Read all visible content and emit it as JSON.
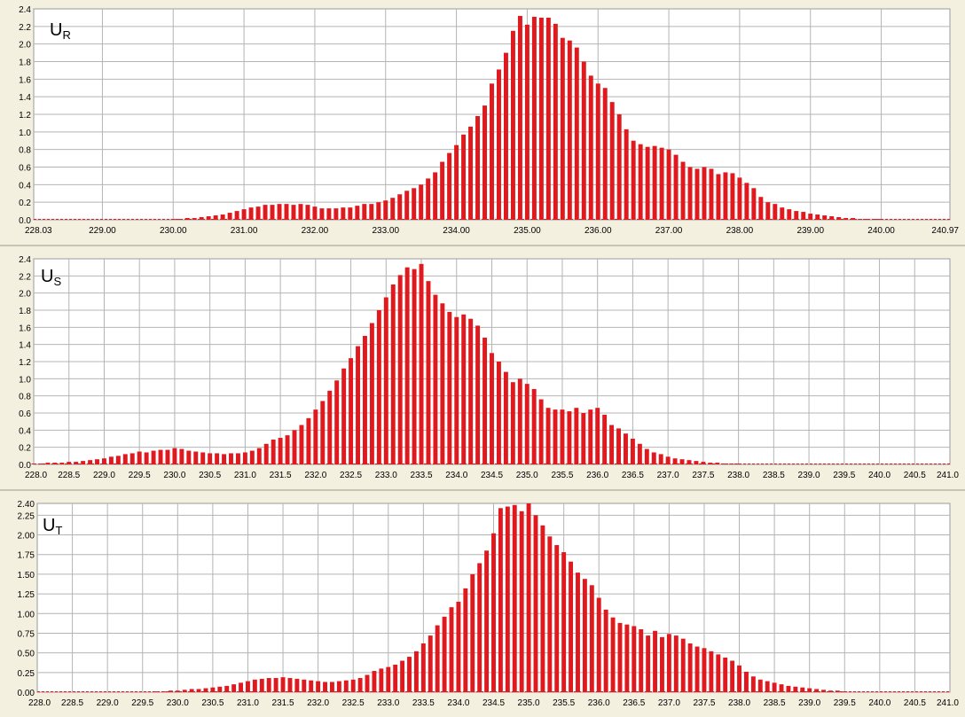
{
  "colors": {
    "bar": "#e0191e",
    "grid": "#b4b4b4",
    "baseline": "#e0191e",
    "panel_bg": "#f4f0e0",
    "plot_bg": "#ffffff"
  },
  "chart_data": [
    {
      "type": "bar",
      "label_main": "U",
      "label_sub": "R",
      "xlim": [
        228.03,
        240.97
      ],
      "ylim": [
        0,
        2.4
      ],
      "x_ticks": [
        "228.03",
        "229.00",
        "230.00",
        "231.00",
        "232.00",
        "233.00",
        "234.00",
        "235.00",
        "236.00",
        "237.00",
        "238.00",
        "239.00",
        "240.00",
        "240.97"
      ],
      "y_ticks": [
        "0.0",
        "0.2",
        "0.4",
        "0.6",
        "0.8",
        "1.0",
        "1.2",
        "1.4",
        "1.6",
        "1.8",
        "2.0",
        "2.2",
        "2.4"
      ],
      "grid": true,
      "x": [
        230.0,
        230.1,
        230.2,
        230.3,
        230.4,
        230.5,
        230.6,
        230.7,
        230.8,
        230.9,
        231.0,
        231.1,
        231.2,
        231.3,
        231.4,
        231.5,
        231.6,
        231.7,
        231.8,
        231.9,
        232.0,
        232.1,
        232.2,
        232.3,
        232.4,
        232.5,
        232.6,
        232.7,
        232.8,
        232.9,
        233.0,
        233.1,
        233.2,
        233.3,
        233.4,
        233.5,
        233.6,
        233.7,
        233.8,
        233.9,
        234.0,
        234.1,
        234.2,
        234.3,
        234.4,
        234.5,
        234.6,
        234.7,
        234.8,
        234.9,
        235.0,
        235.1,
        235.2,
        235.3,
        235.4,
        235.5,
        235.6,
        235.7,
        235.8,
        235.9,
        236.0,
        236.1,
        236.2,
        236.3,
        236.4,
        236.5,
        236.6,
        236.7,
        236.8,
        236.9,
        237.0,
        237.1,
        237.2,
        237.3,
        237.4,
        237.5,
        237.6,
        237.7,
        237.8,
        237.9,
        238.0,
        238.1,
        238.2,
        238.3,
        238.4,
        238.5,
        238.6,
        238.7,
        238.8,
        238.9,
        239.0,
        239.1,
        239.2,
        239.3,
        239.4,
        239.5,
        239.6,
        239.7,
        239.8,
        239.9,
        240.0
      ],
      "values": [
        0.01,
        0.01,
        0.02,
        0.02,
        0.03,
        0.04,
        0.05,
        0.06,
        0.08,
        0.1,
        0.12,
        0.14,
        0.15,
        0.17,
        0.17,
        0.18,
        0.18,
        0.17,
        0.18,
        0.17,
        0.15,
        0.13,
        0.13,
        0.13,
        0.14,
        0.14,
        0.16,
        0.18,
        0.18,
        0.2,
        0.22,
        0.25,
        0.29,
        0.33,
        0.36,
        0.4,
        0.47,
        0.54,
        0.66,
        0.76,
        0.85,
        0.97,
        1.06,
        1.18,
        1.3,
        1.55,
        1.71,
        1.9,
        2.15,
        2.32,
        2.22,
        2.31,
        2.3,
        2.3,
        2.23,
        2.07,
        2.04,
        1.96,
        1.8,
        1.64,
        1.55,
        1.5,
        1.34,
        1.2,
        1.03,
        0.9,
        0.86,
        0.83,
        0.84,
        0.82,
        0.8,
        0.74,
        0.66,
        0.6,
        0.58,
        0.6,
        0.58,
        0.52,
        0.54,
        0.53,
        0.48,
        0.42,
        0.36,
        0.26,
        0.2,
        0.18,
        0.14,
        0.12,
        0.1,
        0.09,
        0.07,
        0.06,
        0.05,
        0.04,
        0.03,
        0.02,
        0.02,
        0.01,
        0.01,
        0.01,
        0.01
      ]
    },
    {
      "type": "bar",
      "label_main": "U",
      "label_sub": "S",
      "xlim": [
        228.0,
        241.0
      ],
      "ylim": [
        0,
        2.4
      ],
      "x_ticks": [
        "228.0",
        "228.5",
        "229.0",
        "229.5",
        "230.0",
        "230.5",
        "231.0",
        "231.5",
        "232.0",
        "232.5",
        "233.0",
        "233.5",
        "234.0",
        "234.5",
        "235.0",
        "235.5",
        "236.0",
        "236.5",
        "237.0",
        "237.5",
        "238.0",
        "238.5",
        "239.0",
        "239.5",
        "240.0",
        "240.5",
        "241.0"
      ],
      "y_ticks": [
        "0.0",
        "0.2",
        "0.4",
        "0.6",
        "0.8",
        "1.0",
        "1.2",
        "1.4",
        "1.6",
        "1.8",
        "2.0",
        "2.2",
        "2.4"
      ],
      "grid": true,
      "x": [
        228.0,
        228.1,
        228.2,
        228.3,
        228.4,
        228.5,
        228.6,
        228.7,
        228.8,
        228.9,
        229.0,
        229.1,
        229.2,
        229.3,
        229.4,
        229.5,
        229.6,
        229.7,
        229.8,
        229.9,
        230.0,
        230.1,
        230.2,
        230.3,
        230.4,
        230.5,
        230.6,
        230.7,
        230.8,
        230.9,
        231.0,
        231.1,
        231.2,
        231.3,
        231.4,
        231.5,
        231.6,
        231.7,
        231.8,
        231.9,
        232.0,
        232.1,
        232.2,
        232.3,
        232.4,
        232.5,
        232.6,
        232.7,
        232.8,
        232.9,
        233.0,
        233.1,
        233.2,
        233.3,
        233.4,
        233.5,
        233.6,
        233.7,
        233.8,
        233.9,
        234.0,
        234.1,
        234.2,
        234.3,
        234.4,
        234.5,
        234.6,
        234.7,
        234.8,
        234.9,
        235.0,
        235.1,
        235.2,
        235.3,
        235.4,
        235.5,
        235.6,
        235.7,
        235.8,
        235.9,
        236.0,
        236.1,
        236.2,
        236.3,
        236.4,
        236.5,
        236.6,
        236.7,
        236.8,
        236.9,
        237.0,
        237.1,
        237.2,
        237.3,
        237.4,
        237.5,
        237.6,
        237.7,
        237.8,
        237.9,
        238.0
      ],
      "values": [
        0.01,
        0.01,
        0.02,
        0.02,
        0.02,
        0.03,
        0.03,
        0.04,
        0.05,
        0.06,
        0.07,
        0.09,
        0.1,
        0.12,
        0.13,
        0.15,
        0.14,
        0.16,
        0.17,
        0.17,
        0.19,
        0.18,
        0.16,
        0.15,
        0.14,
        0.13,
        0.13,
        0.12,
        0.13,
        0.13,
        0.14,
        0.16,
        0.19,
        0.24,
        0.29,
        0.31,
        0.34,
        0.4,
        0.46,
        0.54,
        0.64,
        0.74,
        0.86,
        0.98,
        1.12,
        1.24,
        1.38,
        1.5,
        1.65,
        1.8,
        1.95,
        2.1,
        2.21,
        2.3,
        2.28,
        2.34,
        2.14,
        1.98,
        1.88,
        1.78,
        1.72,
        1.75,
        1.7,
        1.62,
        1.48,
        1.3,
        1.2,
        1.08,
        0.96,
        1.0,
        0.94,
        0.88,
        0.76,
        0.66,
        0.64,
        0.64,
        0.62,
        0.66,
        0.6,
        0.64,
        0.66,
        0.58,
        0.46,
        0.42,
        0.36,
        0.3,
        0.24,
        0.18,
        0.14,
        0.12,
        0.09,
        0.07,
        0.06,
        0.05,
        0.04,
        0.03,
        0.02,
        0.02,
        0.01,
        0.01,
        0.01
      ]
    },
    {
      "type": "bar",
      "label_main": "U",
      "label_sub": "T",
      "xlim": [
        228.0,
        241.0
      ],
      "ylim": [
        0,
        2.4
      ],
      "x_ticks": [
        "228.0",
        "228.5",
        "229.0",
        "229.5",
        "230.0",
        "230.5",
        "231.0",
        "231.5",
        "232.0",
        "232.5",
        "233.0",
        "233.5",
        "234.0",
        "234.5",
        "235.0",
        "235.5",
        "236.0",
        "236.5",
        "237.0",
        "237.5",
        "238.0",
        "238.5",
        "239.0",
        "239.5",
        "240.0",
        "240.5",
        "241.0"
      ],
      "y_ticks": [
        "0.00",
        "0.25",
        "0.50",
        "0.75",
        "1.00",
        "1.25",
        "1.50",
        "1.75",
        "2.00",
        "2.25",
        "2.40"
      ],
      "y_tick_values": [
        0,
        0.25,
        0.5,
        0.75,
        1.0,
        1.25,
        1.5,
        1.75,
        2.0,
        2.25,
        2.4
      ],
      "grid": true,
      "x": [
        229.7,
        229.8,
        229.9,
        230.0,
        230.1,
        230.2,
        230.3,
        230.4,
        230.5,
        230.6,
        230.7,
        230.8,
        230.9,
        231.0,
        231.1,
        231.2,
        231.3,
        231.4,
        231.5,
        231.6,
        231.7,
        231.8,
        231.9,
        232.0,
        232.1,
        232.2,
        232.3,
        232.4,
        232.5,
        232.6,
        232.7,
        232.8,
        232.9,
        233.0,
        233.1,
        233.2,
        233.3,
        233.4,
        233.5,
        233.6,
        233.7,
        233.8,
        233.9,
        234.0,
        234.1,
        234.2,
        234.3,
        234.4,
        234.5,
        234.6,
        234.7,
        234.8,
        234.9,
        235.0,
        235.1,
        235.2,
        235.3,
        235.4,
        235.5,
        235.6,
        235.7,
        235.8,
        235.9,
        236.0,
        236.1,
        236.2,
        236.3,
        236.4,
        236.5,
        236.6,
        236.7,
        236.8,
        236.9,
        237.0,
        237.1,
        237.2,
        237.3,
        237.4,
        237.5,
        237.6,
        237.7,
        237.8,
        237.9,
        238.0,
        238.1,
        238.2,
        238.3,
        238.4,
        238.5,
        238.6,
        238.7,
        238.8,
        238.9,
        239.0,
        239.1,
        239.2,
        239.3,
        239.4,
        239.5
      ],
      "values": [
        0.01,
        0.01,
        0.02,
        0.02,
        0.03,
        0.04,
        0.04,
        0.05,
        0.06,
        0.07,
        0.08,
        0.1,
        0.12,
        0.14,
        0.16,
        0.17,
        0.18,
        0.18,
        0.19,
        0.18,
        0.17,
        0.16,
        0.15,
        0.14,
        0.13,
        0.13,
        0.14,
        0.15,
        0.16,
        0.18,
        0.22,
        0.27,
        0.3,
        0.32,
        0.35,
        0.4,
        0.45,
        0.52,
        0.62,
        0.72,
        0.85,
        0.96,
        1.08,
        1.15,
        1.32,
        1.5,
        1.64,
        1.8,
        2.02,
        2.34,
        2.36,
        2.38,
        2.3,
        2.4,
        2.25,
        2.12,
        1.98,
        1.87,
        1.78,
        1.66,
        1.52,
        1.44,
        1.36,
        1.2,
        1.05,
        0.95,
        0.88,
        0.86,
        0.84,
        0.8,
        0.72,
        0.78,
        0.7,
        0.74,
        0.72,
        0.68,
        0.62,
        0.58,
        0.56,
        0.52,
        0.48,
        0.44,
        0.4,
        0.34,
        0.26,
        0.2,
        0.16,
        0.14,
        0.12,
        0.1,
        0.08,
        0.07,
        0.06,
        0.05,
        0.04,
        0.03,
        0.02,
        0.02,
        0.01
      ]
    }
  ]
}
